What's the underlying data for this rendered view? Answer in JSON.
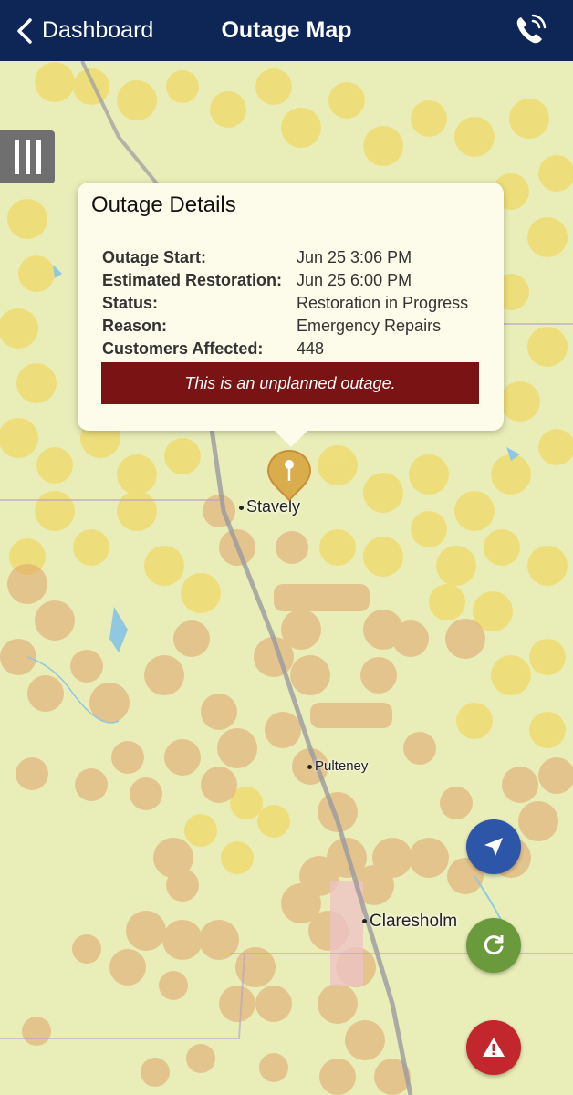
{
  "nav": {
    "back_label": "Dashboard",
    "title": "Outage Map",
    "call_icon": "phone-icon"
  },
  "popup": {
    "title": "Outage Details",
    "rows": [
      {
        "key": "Outage Start:",
        "value": "Jun 25 3:06 PM"
      },
      {
        "key": "Estimated Restoration:",
        "value": "Jun 25 6:00 PM"
      },
      {
        "key": "Status:",
        "value": "Restoration in Progress"
      },
      {
        "key": "Reason:",
        "value": "Emergency Repairs"
      },
      {
        "key": "Customers Affected:",
        "value": "448"
      }
    ],
    "banner": "This is an unplanned outage."
  },
  "map": {
    "labels": {
      "stavely": "Stavely",
      "pulteney": "Pulteney",
      "claresholm": "Claresholm"
    }
  },
  "controls": {
    "menu_icon": "layers-menu-icon",
    "locate_icon": "location-arrow-icon",
    "refresh_icon": "refresh-icon",
    "alert_icon": "warning-icon"
  },
  "colors": {
    "nav_bg": "#0e2655",
    "banner_bg": "#7a1414",
    "hex_yellow": "#f3d24a",
    "hex_orange": "#e0a36a",
    "map_bg": "#e9eeb8"
  }
}
